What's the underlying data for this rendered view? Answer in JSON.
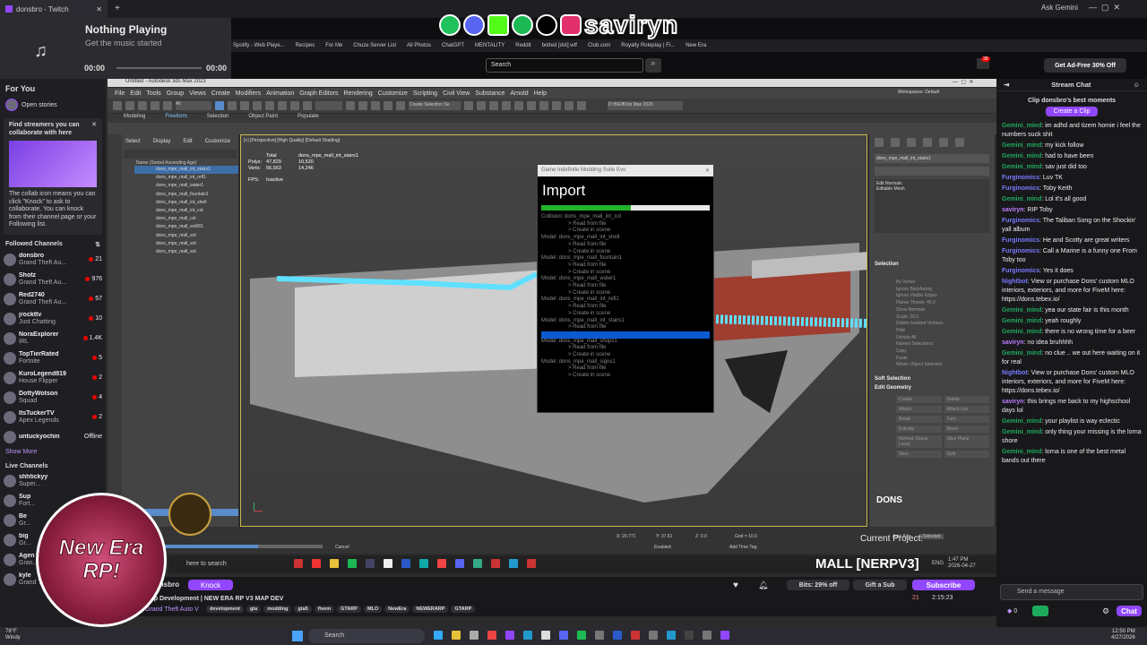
{
  "browser": {
    "tab_title": "donsbro - Twitch",
    "media": {
      "title": "Nothing Playing",
      "subtitle": "Get the music started",
      "time_start": "00:00",
      "time_end": "00:00"
    },
    "bookmarks": [
      "Spotify - Web Playe...",
      "Recipes",
      "For Me",
      "Chuze Server List",
      "All Photos",
      "ChatGPT",
      "MENTALITY",
      "Reddit",
      "botted [dot] wtf",
      "Club.com",
      "Royalty Roleplay | Fi...",
      "New Era"
    ],
    "search_placeholder": "Search",
    "ask": "Ask Gemini",
    "notif_count": "38",
    "adfree": "Get Ad-Free 30% Off"
  },
  "overlay": {
    "name": "saviryn",
    "logo": "New Era RP!",
    "current_project_label": "Current Project:",
    "current_project": "MALL [NERPV3]",
    "dons_logo": "DONS"
  },
  "sidebar": {
    "for_you": "For You",
    "open_stories": "Open stories",
    "collab_title": "Find streamers you can collaborate with here",
    "collab_body": "The collab icon means you can click \"Knock\" to ask to collaborate. You can knock from their channel page or your Following list.",
    "followed_title": "Followed Channels",
    "followed": [
      {
        "name": "donsbro",
        "game": "Grand Theft Au...",
        "count": "21"
      },
      {
        "name": "Shotz",
        "game": "Grand Theft Au...",
        "count": "976"
      },
      {
        "name": "Red2740",
        "game": "Grand Theft Au...",
        "count": "57"
      },
      {
        "name": "jrockttv",
        "game": "Just Chatting",
        "count": "10"
      },
      {
        "name": "NoraExplorer",
        "game": "IRL",
        "count": "1.4K"
      },
      {
        "name": "TopTierRated",
        "game": "Fortnite",
        "count": "5"
      },
      {
        "name": "KuroLegend819",
        "game": "House Flipper",
        "count": "2"
      },
      {
        "name": "DottyWotson",
        "game": "Squad",
        "count": "4"
      },
      {
        "name": "ItsTuckerTV",
        "game": "Apex Legends",
        "count": "2"
      },
      {
        "name": "untuckyochin",
        "game": "",
        "count": "Offline"
      }
    ],
    "show_more": "Show More",
    "live_title": "Live Channels",
    "live": [
      {
        "name": "shhtickyy",
        "game": "Super..."
      },
      {
        "name": "Sup",
        "game": "Fort..."
      },
      {
        "name": "Be",
        "game": "Gr..."
      },
      {
        "name": "big",
        "game": "Gr..."
      },
      {
        "name": "Agen",
        "game": "Gran..."
      },
      {
        "name": "kyle",
        "game": "Grand Theft Au..."
      }
    ]
  },
  "max": {
    "title": "Untitled - Autodesk 3ds Max 2023",
    "menus": [
      "File",
      "Edit",
      "Tools",
      "Group",
      "Views",
      "Create",
      "Modifiers",
      "Animation",
      "Graph Editors",
      "Rendering",
      "Customize",
      "Scripting",
      "Civil View",
      "Substance",
      "Arnold",
      "Help"
    ],
    "workspaces": "Workspaces: Default",
    "ribbon_tabs": [
      "Modeling",
      "Freeform",
      "Selection",
      "Object Paint",
      "Populate"
    ],
    "selection_set": "Create Selection Se",
    "path": "D:\\B\\Effl3ds Max 2020",
    "scene_menus": [
      "Select",
      "Display",
      "Edit",
      "Customize"
    ],
    "scene_header": "Name (Sorted Ascending Age)",
    "scene_items": [
      "dons_mpe_mall_int_stairs1",
      "dons_mpe_mall_int_refl1",
      "dons_mpe_mall_water1",
      "dons_mpe_mall_fountain1",
      "dons_mpe_mall_int_shell",
      "dons_mpe_mall_int_col",
      "dons_mpe_mall_col",
      "dons_mpe_mall_ext001",
      "dons_mpe_mall_ext",
      "dons_mpe_mall_ext",
      "dons_mpe_mall_ext"
    ],
    "viewport_label": "[+] [Perspective] [High Quality] [Default Shading]",
    "stats": {
      "total": "Total",
      "obj": "dons_mpe_mall_int_stairs1",
      "polys_label": "Polys:",
      "polys_total": "47,829",
      "polys_obj": "10,520",
      "verts_label": "Verts:",
      "verts_total": "56,563",
      "verts_obj": "14,246",
      "fps_label": "FPS:",
      "fps": "Inactive"
    },
    "modifier_name": "dons_mpe_mall_int_stairs1",
    "modifier_stack": [
      "Edit Normals",
      "Editable Mesh"
    ],
    "selection_title": "Selection",
    "selection_items": [
      "By Vertex",
      "Ignore Backfacing",
      "Ignore Visible Edges",
      "Planar Thresh: 45.0",
      "Show Normals",
      "Scale: 20.0",
      "Delete Isolated Vertices",
      "Hide",
      "Unhide All",
      "Named Selections:",
      "Copy",
      "Paste",
      "Whole Object Selected"
    ],
    "soft_selection": "Soft Selection",
    "edit_geometry": "Edit Geometry",
    "edit_geom_buttons": [
      "Create",
      "Delete",
      "Attach",
      "Attach List",
      "Break",
      "Turn",
      "Extrude",
      "Bevel",
      "Normal: Group Local",
      "Slice Plane",
      "Slice",
      "Split"
    ],
    "grid": "Grid = 10.0",
    "auto_key": "Auto Key",
    "selected": "Selected",
    "add_time_tag": "Add Time Tag",
    "enabled": "Enabled:",
    "cancel": "Cancel",
    "coords": {
      "x": "X: 20.771",
      "y": "Y: 37.61",
      "z": "Z: 0.0"
    }
  },
  "import_dialog": {
    "window_title": "Game Indefinite Modding Suite Evo",
    "heading": "Import",
    "progress": 0.53,
    "lines": [
      "Collision: dons_mpe_mall_int_col",
      "> Read from file",
      "> Create in scene",
      "Model: dons_mpe_mall_int_shell",
      "> Read from file",
      "> Create in scene",
      "Model: dons_mpe_mall_fountain1",
      "> Read from file",
      "> Create in scene",
      "Model: dons_mpe_mall_water1",
      "> Read from file",
      "> Create in scene",
      "Model: dons_mpe_mall_int_refl1",
      "> Read from file",
      "> Create in scene",
      "Model: dons_mpe_mall_int_stairs1",
      "> Read from file",
      "> Create in scene",
      "Model: dons_mpe_mall_shops1",
      "> Read from file",
      "> Create in scene",
      "Model: dons_mpe_mall_signs1",
      "> Read from file",
      "> Create in scene"
    ],
    "highlight_index": 17
  },
  "inner_taskbar": {
    "search": "here to search",
    "lang": "ENG",
    "time": "1:47 PM",
    "date": "2026-04-27"
  },
  "stream": {
    "channel": "donsbro",
    "knock": "Knock",
    "title": "Map Development | NEW ERA RP V3 MAP DEV",
    "game": "Grand Theft Auto V",
    "tags": [
      "development",
      "gta",
      "modding",
      "gta5",
      "fivem",
      "GTARP",
      "MLO",
      "NewEra",
      "NEWERARP",
      "GTARP"
    ],
    "bits": "Bits: 29% off",
    "gift": "Gift a Sub",
    "subscribe": "Subscribe",
    "viewers": "21",
    "uptime": "2:15:23"
  },
  "chat": {
    "title": "Stream Chat",
    "clip_title": "Clip donsbro's best moments",
    "clip_button": "Create a Clip",
    "messages": [
      {
        "user": "Gemini_mind",
        "text": "im adhd and tizem homie i feel the numbers suck shit"
      },
      {
        "user": "Gemini_mind",
        "text": "my kick follow"
      },
      {
        "user": "Gemini_mind",
        "text": "had to have been"
      },
      {
        "user": "Gemini_mind",
        "text": "sav just did too"
      },
      {
        "user": "Furginomics",
        "text": "Luv TK"
      },
      {
        "user": "Furginomics",
        "text": "Toby Keith"
      },
      {
        "user": "Gemini_mind",
        "text": "Lol it's all good"
      },
      {
        "user": "saviryn",
        "text": "RIP Toby"
      },
      {
        "user": "Furginomics",
        "text": "The Taliban Song on the Shockin' yall album"
      },
      {
        "user": "Furginomics",
        "text": "He and Scotty are great writers"
      },
      {
        "user": "Furginomics",
        "text": "Call a Marine is a funny one From Toby too"
      },
      {
        "user": "Furginomics",
        "text": "Yes it does"
      },
      {
        "user": "Nightbot",
        "text": "View or purchase Dons' custom MLO interiors, exteriors, and more for FiveM here: https://dons.tebex.io/"
      },
      {
        "user": "Gemini_mind",
        "text": "yea our state fair is this month"
      },
      {
        "user": "Gemini_mind",
        "text": "yeah roughly"
      },
      {
        "user": "Gemini_mind",
        "text": "there is no wrong time for a beer"
      },
      {
        "user": "saviryn",
        "text": "no idea bruhhhh"
      },
      {
        "user": "Gemini_mind",
        "text": "no clue .. we out here waiting on it for real"
      },
      {
        "user": "Nightbot",
        "text": "View or purchase Dons' custom MLO interiors, exteriors, and more for FiveM here: https://dons.tebex.io/"
      },
      {
        "user": "saviryn",
        "text": "this brings me back to my highschool days lol"
      },
      {
        "user": "Gemini_mind",
        "text": "your playlist is way eclectic"
      },
      {
        "user": "Gemini_mind",
        "text": "only thing your missing is the lorna shore"
      },
      {
        "user": "Gemini_mind",
        "text": "lorna is one of the best metal bands out there"
      }
    ],
    "input_placeholder": "Send a message",
    "points": "0",
    "send": "Chat"
  },
  "taskbar": {
    "weather_temp": "78°F",
    "weather_desc": "Windy",
    "search": "Search",
    "time": "12:50 PM",
    "date": "4/27/2026"
  }
}
